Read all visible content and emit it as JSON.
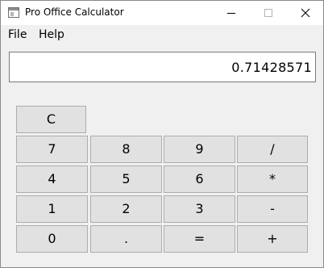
{
  "window": {
    "title": "Pro Office Calculator"
  },
  "menu": {
    "file": "File",
    "help": "Help"
  },
  "display": {
    "value": "0.71428571"
  },
  "keys": {
    "clear": "C",
    "seven": "7",
    "eight": "8",
    "nine": "9",
    "divide": "/",
    "four": "4",
    "five": "5",
    "six": "6",
    "multiply": "*",
    "one": "1",
    "two": "2",
    "three": "3",
    "subtract": "-",
    "zero": "0",
    "point": ".",
    "equals": "=",
    "add": "+"
  }
}
